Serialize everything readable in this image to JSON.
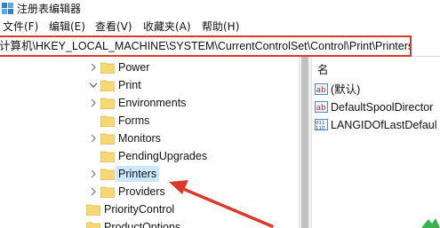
{
  "window": {
    "title": "注册表编辑器"
  },
  "menu": [
    "文件(F)",
    "编辑(E)",
    "查看(V)",
    "收藏夹(A)",
    "帮助(H)"
  ],
  "address": {
    "path": "计算机\\HKEY_LOCAL_MACHINE\\SYSTEM\\CurrentControlSet\\Control\\Print\\Printers"
  },
  "tree": [
    {
      "label": "Power",
      "chevron": "right"
    },
    {
      "label": "Print",
      "chevron": "down"
    },
    {
      "label": "Environments",
      "chevron": "right"
    },
    {
      "label": "Forms",
      "chevron": "none"
    },
    {
      "label": "Monitors",
      "chevron": "right"
    },
    {
      "label": "PendingUpgrades",
      "chevron": "none"
    },
    {
      "label": "Printers",
      "chevron": "right",
      "selected": true
    },
    {
      "label": "Providers",
      "chevron": "right"
    },
    {
      "label": "PriorityControl",
      "chevron": "none"
    },
    {
      "label": "ProductOptions",
      "chevron": "none"
    }
  ],
  "list": {
    "header": "名",
    "rows": [
      {
        "label": "(默认)",
        "icon": "string-value-icon"
      },
      {
        "label": "DefaultSpoolDirector",
        "icon": "string-value-icon"
      },
      {
        "label": "LANGIDOfLastDefaul",
        "icon": "binary-value-icon"
      }
    ]
  },
  "colors": {
    "highlight": "#d93a2b",
    "selection": "#cce8ff",
    "folder": "#f8d775"
  }
}
